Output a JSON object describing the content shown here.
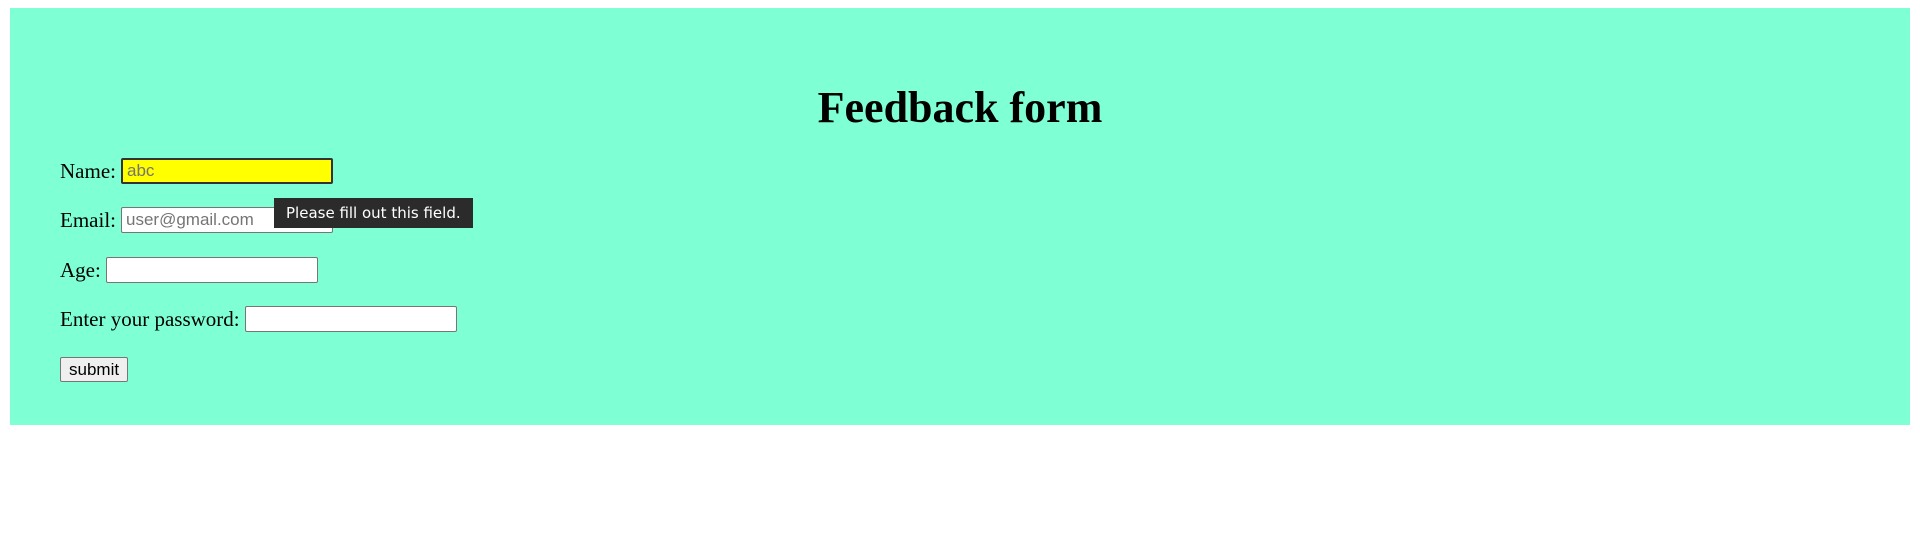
{
  "form": {
    "title": "Feedback form",
    "fields": {
      "name": {
        "label": "Name:",
        "value": "",
        "placeholder": "abc"
      },
      "email": {
        "label": "Email:",
        "value": "",
        "placeholder": "user@gmail.com"
      },
      "age": {
        "label": "Age:",
        "value": "",
        "placeholder": ""
      },
      "password": {
        "label": "Enter your password:",
        "value": "",
        "placeholder": ""
      }
    },
    "submit_label": "submit"
  },
  "validation_tooltip": {
    "text": "Please fill out this field."
  },
  "colors": {
    "panel_background": "#7fffd4",
    "focused_input_background": "#ffff00",
    "tooltip_background": "#2b2b2b"
  }
}
